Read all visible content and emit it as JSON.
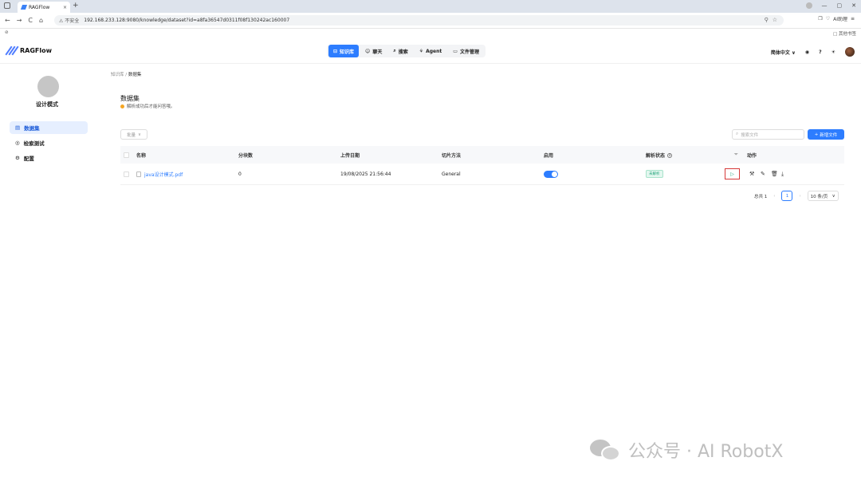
{
  "browser": {
    "tab_title": "RAGFlow",
    "tab_close": "×",
    "new_tab": "+",
    "nav": [
      "←",
      "→",
      "C",
      "⌂"
    ],
    "insecure_label": "⚠ 不安全",
    "url": "192.168.233.128:9080/knowledge/dataset?id=a8fa36547d0311f08f130242ac160007",
    "ai_label": "AI助理",
    "bookmark_right": "□ 其他书签",
    "win_controls": [
      "—",
      "▢",
      "✕"
    ]
  },
  "app": {
    "brand": "RAGFlow",
    "nav": [
      {
        "icon": "⊟",
        "label": "知识库",
        "active": true
      },
      {
        "icon": "☺",
        "label": "聊天",
        "active": false
      },
      {
        "icon": "⌕",
        "label": "搜索",
        "active": false
      },
      {
        "icon": "⚘",
        "label": "Agent",
        "active": false
      },
      {
        "icon": "▭",
        "label": "文件管理",
        "active": false
      }
    ],
    "language": "简体中文 ∨",
    "header_icons": [
      "github-icon",
      "help-icon",
      "theme-icon"
    ]
  },
  "sidebar": {
    "kb_name": "设计模式",
    "items": [
      {
        "icon": "▤",
        "label": "数据集",
        "active": true
      },
      {
        "icon": "◎",
        "label": "检索测试",
        "active": false
      },
      {
        "icon": "⚙",
        "label": "配置",
        "active": false
      }
    ]
  },
  "breadcrumb": {
    "parent": "知识库",
    "sep": "/",
    "current": "数据集"
  },
  "dataset": {
    "title": "数据集",
    "hint": "解析成功后才能问答哦。",
    "bulk_label": "批量",
    "search_placeholder": "搜索文件",
    "add_label": "新增文件",
    "columns": [
      "名称",
      "分块数",
      "上传日期",
      "切片方法",
      "启用",
      "解析状态",
      "动作"
    ],
    "rows": [
      {
        "name": "java设计模式.pdf",
        "chunks": "0",
        "upload_date": "19/08/2025 21:56:44",
        "method": "General",
        "enabled": true,
        "status": "未解析"
      }
    ]
  },
  "pagination": {
    "total": "总共 1",
    "current_page": "1",
    "page_size": "10 条/页",
    "prev": "‹",
    "next": "›"
  },
  "watermark": {
    "text": "公众号 · AI RobotX"
  },
  "colors": {
    "accent": "#2d7dff",
    "success": "#22a37a",
    "highlight": "#d63a3a"
  }
}
